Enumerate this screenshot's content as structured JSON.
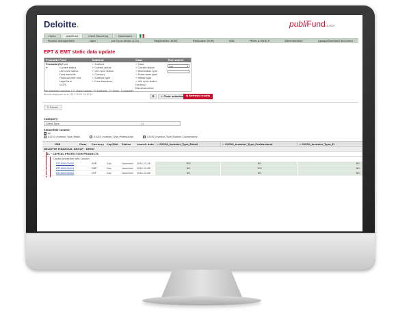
{
  "header": {
    "logo": "Deloitte",
    "logo_dot": ".",
    "product_prefix": "publi",
    "product_name": "Fund",
    "product_version": "v3.0007"
  },
  "top_tabs": [
    "Home",
    "publiFund",
    "Client Reporting",
    "Dashboard"
  ],
  "menu": [
    "Product management",
    "Data",
    "Life Cycle Status (LCS)",
    "Registration (ROM)",
    "Publication (FUR)",
    "KIID",
    "PRIIPs & MiFID II",
    "Administration",
    "Upload/Download document"
  ],
  "page_title": "EPT & EMT static data update",
  "filter": {
    "headers": [
      "Promoter",
      "Fund",
      "Subfund",
      "Class",
      "Text search"
    ],
    "promoter": "Promoter(1) +",
    "fund_items": [
      "Fund",
      "Current status",
      "Life cycle status",
      "Fund domicile",
      "Financial year end",
      "Legal form",
      "UCITS"
    ],
    "subfund_items": [
      "Subfund",
      "Current status",
      "Life cycle status",
      "Currency",
      "Subfund type",
      "Price frequency"
    ],
    "class_items": [
      "Class",
      "Current status",
      "Distribution type",
      "Share class type",
      "Hedge type",
      "Life cycle status",
      "Currency",
      "Silent/cancelled"
    ],
    "search_select": "ISIN",
    "summary": "This selection contains 177 share classes, 70 subfunds, 22 funds, 1 promoter.",
    "summary2": "Results displayed as at 2017-10-04 12:40:15",
    "star": "★",
    "clear_label": "✕ Clear selection",
    "refresh_label": "Q Refresh results"
  },
  "export_label": "Export",
  "category": {
    "label": "Category:",
    "value": "Client Type",
    "caret": "| x"
  },
  "show_hide": {
    "label": "Show/Hide column:",
    "all": "All",
    "options": [
      "01010_Investor_Type_Retail",
      "01020_Investor_Type_Professional",
      "01030_Investor_Type_Eligible_Counterparty"
    ]
  },
  "grid": {
    "columns": [
      "ISIN",
      "Class",
      "Currency",
      "Cap/Dist",
      "Status",
      "Launch date"
    ],
    "investor_columns": [
      "01010_Investor_Type_Retail",
      "01020_Investor_Type_Professional",
      "01030_Investor_Type_El"
    ],
    "group": "DELOITTE FINANCIAL GROUP - DEMO",
    "subgroup": "11 - CAPITAL PROTECTION PRODUCTS",
    "subgroup2": "Capital protection with Coupon",
    "rows": [
      {
        "isin": "DT1800000400",
        "class": "",
        "currency": "EUR",
        "cap": "Cap",
        "status": "Launched",
        "launch": "2014-12-26",
        "v1": "YES",
        "v2": "NO",
        "v3": "NO"
      },
      {
        "isin": "DT1800000401",
        "class": "",
        "currency": "GBP",
        "cap": "Cap",
        "status": "Launched",
        "launch": "2014-12-08",
        "v1": "NO",
        "v2": "YES",
        "v3": "NO"
      },
      {
        "isin": "DT1800000402",
        "class": "",
        "currency": "CHF",
        "cap": "Cap",
        "status": "Launched",
        "launch": "2014-12-08",
        "v1": "NO",
        "v2": "NO",
        "v3": "NO"
      }
    ]
  }
}
